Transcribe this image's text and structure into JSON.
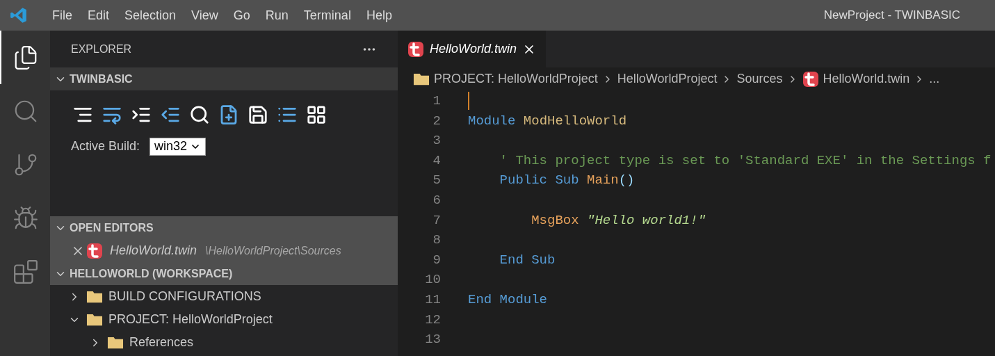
{
  "window": {
    "title": "NewProject - TWINBASIC"
  },
  "menu": [
    "File",
    "Edit",
    "Selection",
    "View",
    "Go",
    "Run",
    "Terminal",
    "Help"
  ],
  "activity_bar": [
    {
      "selected": true
    },
    {
      "selected": false
    },
    {
      "selected": false
    },
    {
      "selected": false
    },
    {
      "selected": false
    }
  ],
  "sidebar": {
    "title": "EXPLORER",
    "twinbasic": {
      "label": "TWINBASIC",
      "expanded": true,
      "active_build": {
        "label": "Active Build:",
        "value": "win32"
      }
    },
    "open_editors": {
      "label": "OPEN EDITORS",
      "expanded": true,
      "items": [
        {
          "name": "HelloWorld.twin",
          "path": "\\HelloWorldProject\\Sources"
        }
      ]
    },
    "workspace": {
      "label": "HELLOWORLD (WORKSPACE)",
      "expanded": true,
      "tree": [
        {
          "label": "BUILD CONFIGURATIONS",
          "expanded": false
        },
        {
          "label": "PROJECT: HelloWorldProject",
          "expanded": true,
          "children": [
            {
              "label": "References",
              "expanded": false
            }
          ]
        }
      ]
    }
  },
  "editor": {
    "tabs": [
      {
        "label": "HelloWorld.twin",
        "selected": true
      }
    ],
    "breadcrumbs": [
      {
        "kind": "folder",
        "label": "PROJECT: HelloWorldProject"
      },
      {
        "kind": "plain",
        "label": "HelloWorldProject"
      },
      {
        "kind": "plain",
        "label": "Sources"
      },
      {
        "kind": "file",
        "label": "HelloWorld.twin"
      },
      {
        "kind": "plain",
        "label": "..."
      }
    ],
    "lines": [
      {
        "number": "1",
        "cursor": true
      },
      {
        "number": "2",
        "cursor": false,
        "tokens": [
          {
            "kind": "keyword",
            "text": "Module "
          },
          {
            "kind": "type",
            "text": "ModHelloWorld"
          }
        ]
      },
      {
        "number": "3",
        "cursor": false
      },
      {
        "number": "4",
        "cursor": false,
        "tokens": [
          {
            "kind": "comment",
            "text": "    ' This project type is set to 'Standard EXE' in the Settings f"
          }
        ]
      },
      {
        "number": "5",
        "cursor": false,
        "tokens": [
          {
            "kind": "keyword",
            "text": "    Public Sub "
          },
          {
            "kind": "function",
            "text": "Main"
          },
          {
            "kind": "punct",
            "text": "()"
          }
        ]
      },
      {
        "number": "6",
        "cursor": false
      },
      {
        "number": "7",
        "cursor": false,
        "tokens": [
          {
            "kind": "function",
            "text": "        MsgBox "
          },
          {
            "kind": "string",
            "text": "\"Hello world1!\""
          }
        ]
      },
      {
        "number": "8",
        "cursor": false
      },
      {
        "number": "9",
        "cursor": false,
        "tokens": [
          {
            "kind": "keyword",
            "text": "    End Sub"
          }
        ]
      },
      {
        "number": "10",
        "cursor": false
      },
      {
        "number": "11",
        "cursor": false,
        "tokens": [
          {
            "kind": "keyword",
            "text": "End Module"
          }
        ]
      },
      {
        "number": "12",
        "cursor": false
      },
      {
        "number": "13",
        "cursor": false
      }
    ]
  }
}
